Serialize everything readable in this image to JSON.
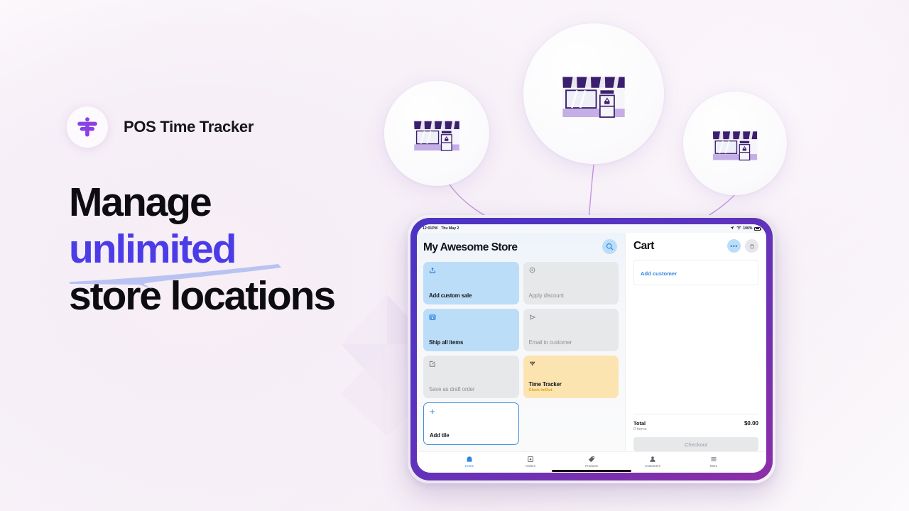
{
  "brand": {
    "name": "POS Time Tracker",
    "logo_icon": "pos-time-tracker-logo",
    "accent": "#7b33e0"
  },
  "headline": {
    "line1": "Manage",
    "line2_accent": "unlimited",
    "line3": "store locations",
    "accent_color": "#4b3ce8",
    "text_color": "#0d0c11"
  },
  "illustrations": {
    "store_icon_name": "storefront-illustration",
    "circles": [
      {
        "id": "store-left",
        "label": "storefront-small-left"
      },
      {
        "id": "store-main",
        "label": "storefront-large-center"
      },
      {
        "id": "store-right",
        "label": "storefront-small-right"
      }
    ]
  },
  "device": {
    "bezel_color": "#5a33bf",
    "statusbar": {
      "time": "12:01PM",
      "date": "Thu May 2",
      "location_icon": "location-arrow-icon",
      "wifi_icon": "wifi-icon",
      "battery_text": "100%",
      "battery_icon": "battery-icon"
    },
    "tiles_pane": {
      "store_title": "My Awesome Store",
      "search_icon": "search-icon",
      "tiles": [
        {
          "label": "Add custom sale",
          "sub": "",
          "style": "blue",
          "icon": "upload-icon",
          "muted": false
        },
        {
          "label": "Apply discount",
          "sub": "",
          "style": "gray",
          "icon": "discount-icon",
          "muted": true
        },
        {
          "label": "Ship all items",
          "sub": "",
          "style": "blue",
          "icon": "box-icon",
          "muted": false
        },
        {
          "label": "Email to customer",
          "sub": "",
          "style": "gray",
          "icon": "send-icon",
          "muted": true
        },
        {
          "label": "Save as draft order",
          "sub": "",
          "style": "gray",
          "icon": "edit-icon",
          "muted": true
        },
        {
          "label": "Time Tracker",
          "sub": "Clock In/Out",
          "style": "amber",
          "icon": "time-tracker-icon",
          "muted": false
        },
        {
          "label": "Add tile",
          "sub": "",
          "style": "add",
          "icon": "plus-icon",
          "muted": false
        }
      ],
      "pager": {
        "dot": "●",
        "plus": "+"
      }
    },
    "cart": {
      "title": "Cart",
      "more_icon": "more-options-icon",
      "delete_icon": "trash-icon",
      "add_customer": "Add customer",
      "total_label": "Total",
      "total_items": "0 items",
      "total_amount": "$0.00",
      "checkout_label": "Checkout"
    },
    "bottom_nav": [
      {
        "label": "Home",
        "icon": "home-icon",
        "active": true
      },
      {
        "label": "Orders",
        "icon": "orders-icon",
        "active": false
      },
      {
        "label": "Products",
        "icon": "products-tag-icon",
        "active": false
      },
      {
        "label": "Customers",
        "icon": "customers-icon",
        "active": false
      },
      {
        "label": "More",
        "icon": "more-menu-icon",
        "active": false
      }
    ]
  }
}
